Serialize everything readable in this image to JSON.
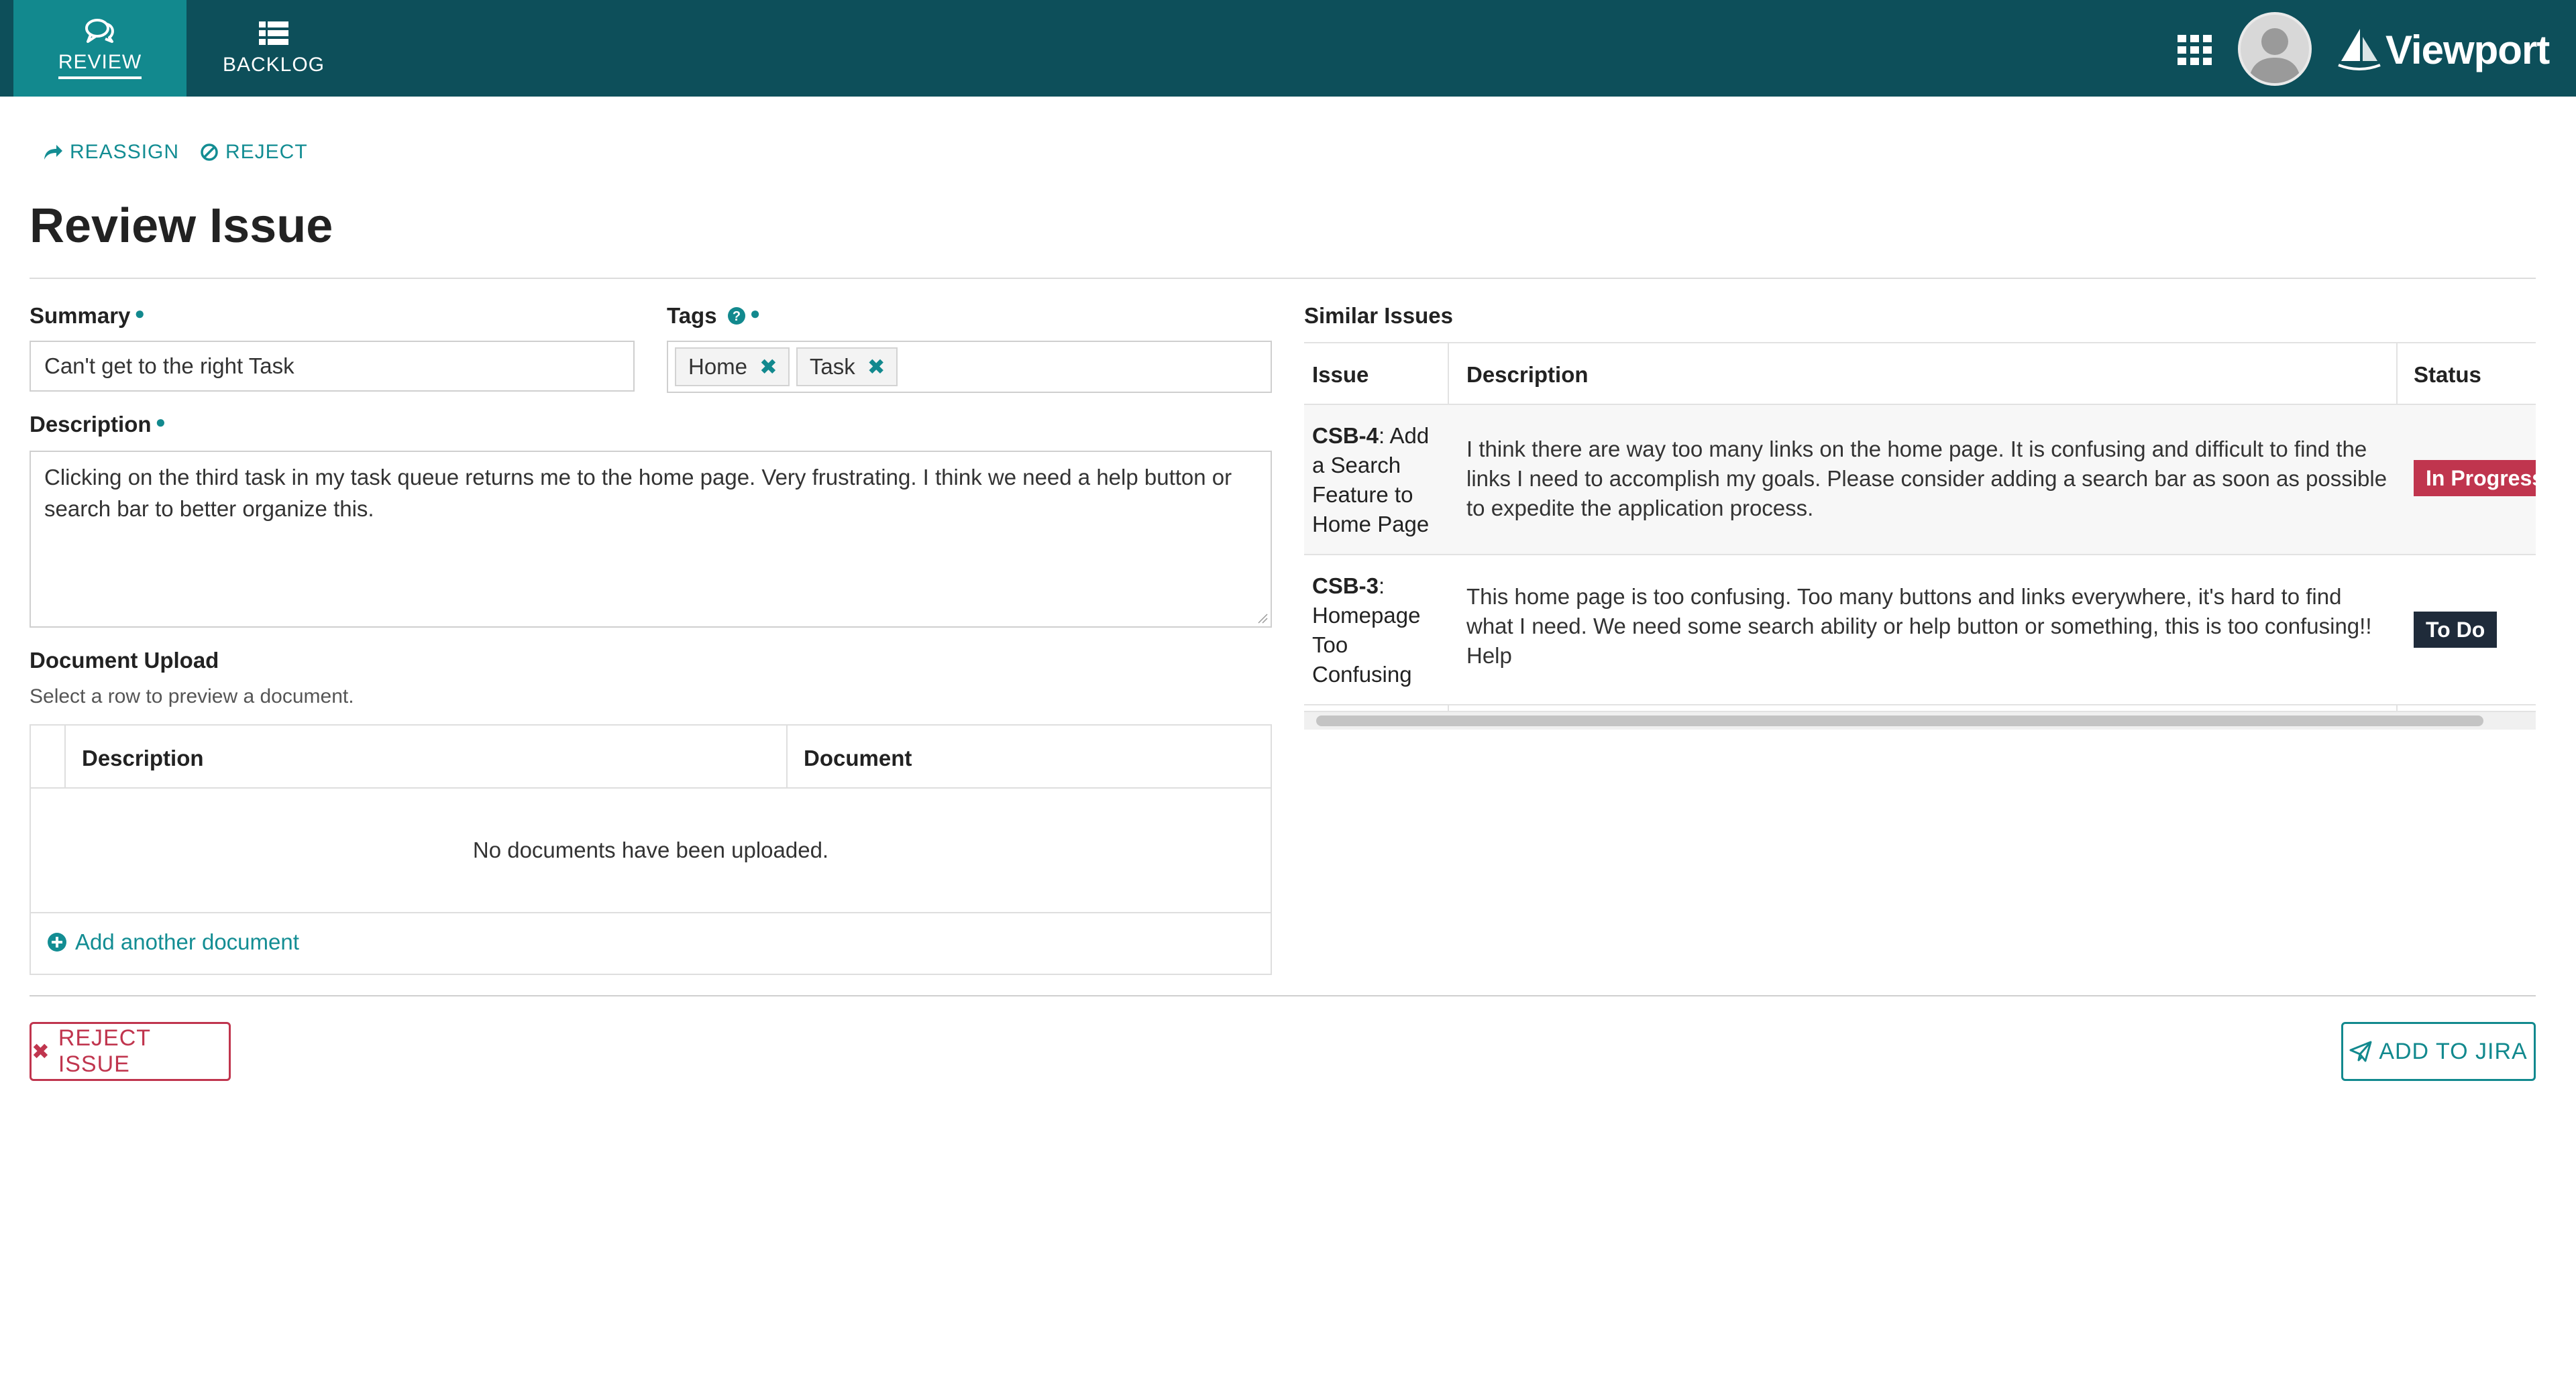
{
  "nav": {
    "tabs": [
      {
        "label": "REVIEW",
        "icon": "chat-bubbles-icon",
        "active": true
      },
      {
        "label": "BACKLOG",
        "icon": "list-icon",
        "active": false
      }
    ],
    "brand": "Viewport"
  },
  "actions": {
    "reassign": "REASSIGN",
    "reject": "REJECT"
  },
  "page_title": "Review Issue",
  "form": {
    "summary": {
      "label": "Summary",
      "value": "Can't get to the right Task"
    },
    "tags": {
      "label": "Tags",
      "items": [
        "Home",
        "Task"
      ]
    },
    "description": {
      "label": "Description",
      "value": "Clicking on the third task in my task queue returns me to the home page. Very frustrating. I think we need a help button or search bar to better organize this."
    },
    "upload": {
      "label": "Document Upload",
      "hint": "Select a row to preview a document.",
      "columns": [
        "Description",
        "Document"
      ],
      "empty_text": "No documents have been uploaded.",
      "add_label": "Add another document"
    }
  },
  "similar": {
    "label": "Similar Issues",
    "columns": [
      "Issue",
      "Description",
      "Status"
    ],
    "rows": [
      {
        "key": "CSB-4",
        "title": ": Add a Search Feature to Home Page",
        "description": "I think there are way too many links on the home page. It is confusing and difficult to find the links I need to accomplish my goals. Please consider adding a search bar as soon as possible to expedite the application process.",
        "status": "In Progress",
        "status_color": "#c0354e"
      },
      {
        "key": "CSB-3",
        "title": ": Homepage Too Confusing",
        "description": "This home page is too confusing. Too many buttons and links everywhere, it's hard to find what I need. We need some search ability or help button or something, this is too confusing!! Help",
        "status": "To Do",
        "status_color": "#1f2b3a"
      }
    ]
  },
  "footer": {
    "reject_issue": "REJECT ISSUE",
    "add_to_jira": "ADD TO JIRA"
  },
  "colors": {
    "header_bg": "#0d4f5a",
    "accent": "#12898e",
    "danger": "#c0354e"
  }
}
